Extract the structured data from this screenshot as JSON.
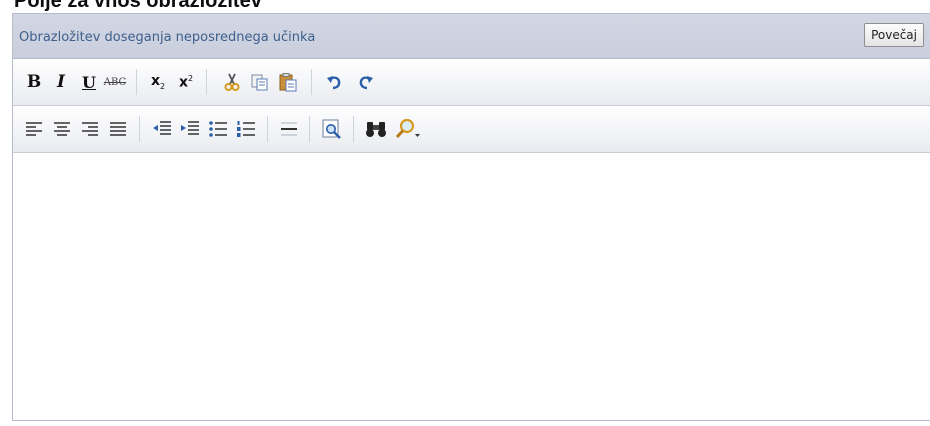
{
  "page": {
    "heading": "Polje za vnos obrazložitev"
  },
  "editor": {
    "title": "Obrazložitev doseganja neposrednega učinka",
    "enlarge_label": "Povečaj",
    "content": ""
  },
  "toolbar_row_1": {
    "buttons": [
      {
        "name": "bold",
        "glyph": "B"
      },
      {
        "name": "italic",
        "glyph": "I"
      },
      {
        "name": "underline",
        "glyph": "U"
      },
      {
        "name": "strikethrough",
        "glyph": "ABC"
      },
      {
        "name": "subscript",
        "glyph": "x"
      },
      {
        "name": "superscript",
        "glyph": "x"
      },
      {
        "name": "cut",
        "icon": "scissors-icon"
      },
      {
        "name": "copy",
        "icon": "copy-icon"
      },
      {
        "name": "paste",
        "icon": "paste-icon"
      },
      {
        "name": "undo",
        "icon": "undo-icon"
      },
      {
        "name": "redo",
        "icon": "redo-icon"
      }
    ],
    "sub_script": "2",
    "super_script": "2"
  },
  "toolbar_row_2": {
    "buttons": [
      {
        "name": "align-left",
        "icon": "align-left-icon"
      },
      {
        "name": "align-center",
        "icon": "align-center-icon"
      },
      {
        "name": "align-right",
        "icon": "align-right-icon"
      },
      {
        "name": "align-justify",
        "icon": "align-justify-icon"
      },
      {
        "name": "outdent",
        "icon": "outdent-icon"
      },
      {
        "name": "indent",
        "icon": "indent-icon"
      },
      {
        "name": "bulleted-list",
        "icon": "bulleted-list-icon"
      },
      {
        "name": "numbered-list",
        "icon": "numbered-list-icon"
      },
      {
        "name": "horizontal-rule",
        "icon": "horizontal-rule-icon"
      },
      {
        "name": "preview",
        "icon": "preview-icon"
      },
      {
        "name": "find",
        "icon": "binoculars-icon"
      },
      {
        "name": "zoom",
        "icon": "magnifier-icon"
      }
    ]
  },
  "colors": {
    "header_bg": "#cdd1df",
    "title_text": "#3d5f8c",
    "icon_blue": "#2a5ea8",
    "icon_gold": "#d79a1f",
    "border": "#b7bccb"
  }
}
